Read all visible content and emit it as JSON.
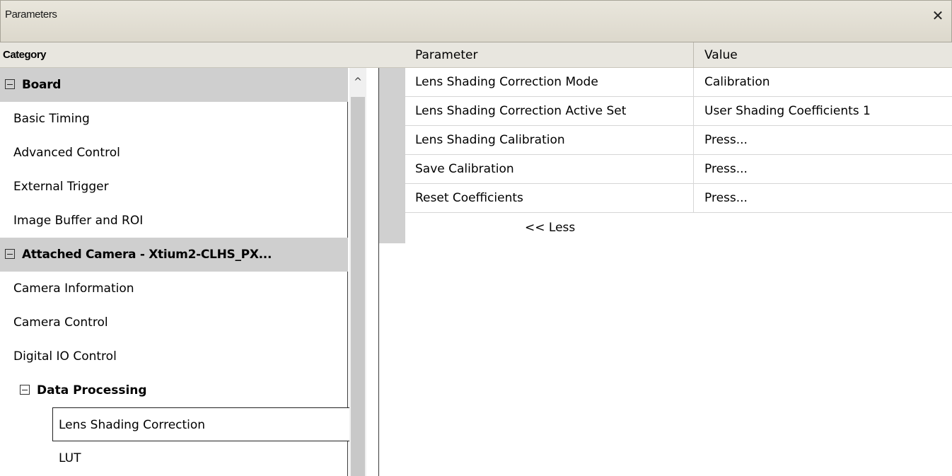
{
  "window": {
    "title": "Parameters",
    "close_icon": "close-icon"
  },
  "columns": {
    "category": "Category",
    "parameter": "Parameter",
    "value": "Value"
  },
  "tree": {
    "items": [
      {
        "label": "Board",
        "type": "group"
      },
      {
        "label": "Basic Timing",
        "type": "item"
      },
      {
        "label": "Advanced Control",
        "type": "item"
      },
      {
        "label": "External Trigger",
        "type": "item"
      },
      {
        "label": "Image Buffer and ROI",
        "type": "item"
      },
      {
        "label": "Attached Camera - Xtium2-CLHS_PX...",
        "type": "group"
      },
      {
        "label": "Camera Information",
        "type": "item"
      },
      {
        "label": "Camera Control",
        "type": "item"
      },
      {
        "label": "Digital IO Control",
        "type": "item"
      },
      {
        "label": "Data Processing",
        "type": "subgroup"
      },
      {
        "label": "Lens Shading Correction",
        "type": "subitem",
        "selected": true
      },
      {
        "label": "LUT",
        "type": "subitem"
      }
    ]
  },
  "parameters": [
    {
      "name": "Lens Shading Correction Mode",
      "value": "Calibration"
    },
    {
      "name": "Lens Shading Correction Active Set",
      "value": "User Shading Coefficients 1"
    },
    {
      "name": "Lens Shading Calibration",
      "value": "Press..."
    },
    {
      "name": "Save Calibration",
      "value": "Press..."
    },
    {
      "name": "Reset Coefficients",
      "value": "Press..."
    }
  ],
  "less_link": "<< Less"
}
